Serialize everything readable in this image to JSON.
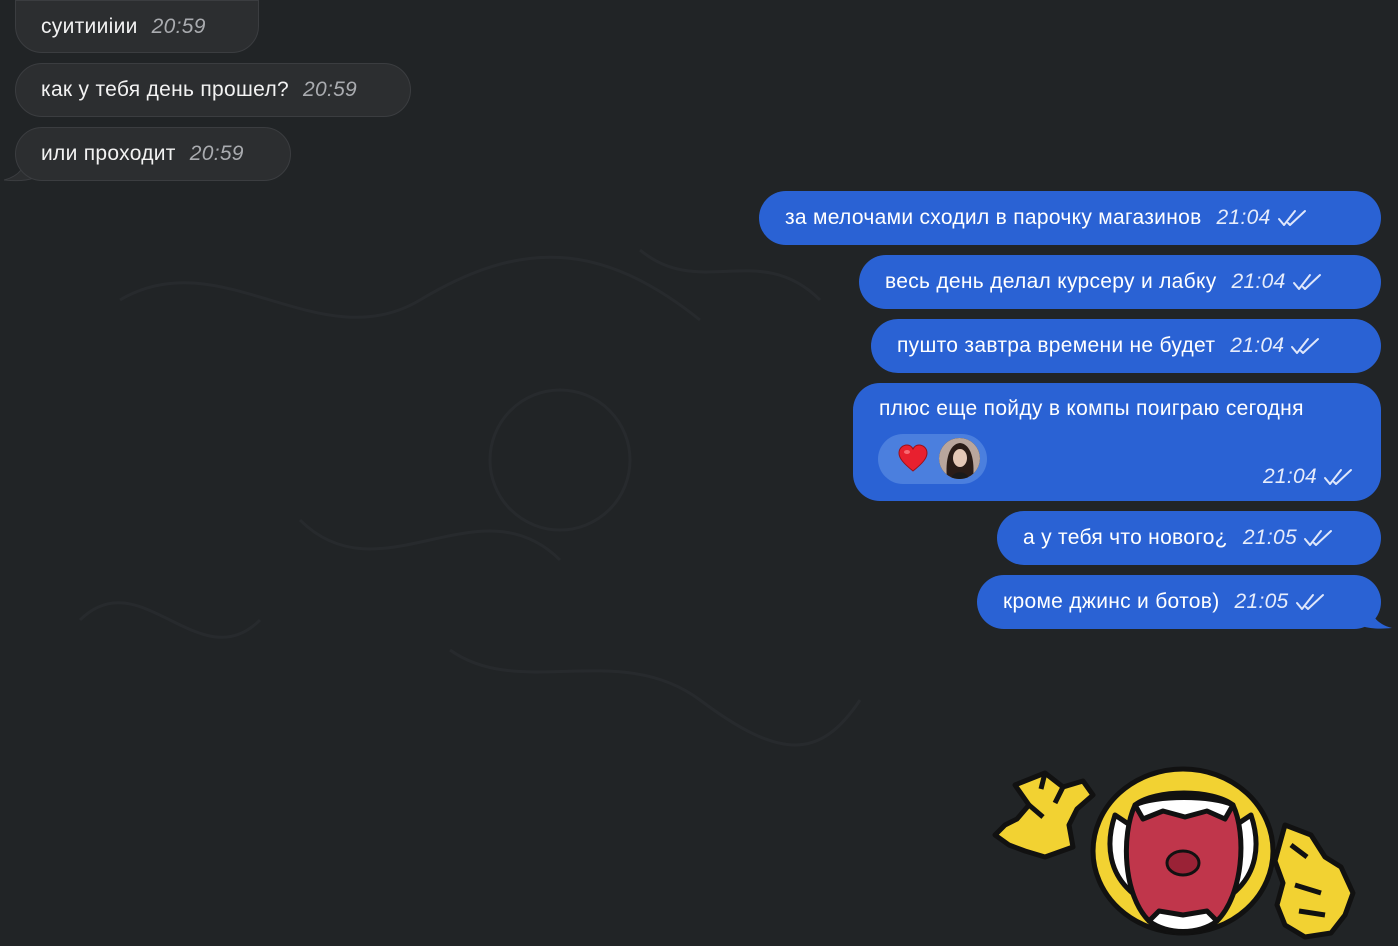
{
  "incoming": [
    {
      "text": "суитииiии",
      "time": "20:59"
    },
    {
      "text": "как у тебя день прошел?",
      "time": "20:59"
    },
    {
      "text": "или проходит",
      "time": "20:59"
    }
  ],
  "outgoing": [
    {
      "text": "за мелочами сходил в парочку магазинов",
      "time": "21:04"
    },
    {
      "text": "весь день делал курсеру и лабку",
      "time": "21:04"
    },
    {
      "text": "пушто завтра времени не будет",
      "time": "21:04"
    },
    {
      "text": "плюс еще пойду в компы поиграю сегодня",
      "time": "21:04",
      "reaction": "heart"
    },
    {
      "text": "а у тебя что нового¿",
      "time": "21:05"
    },
    {
      "text": "кроме джинс и ботов)",
      "time": "21:05"
    }
  ],
  "colors": {
    "background": "#212426",
    "incoming_bubble": "#2c2e30",
    "outgoing_bubble": "#2a62d4",
    "reaction_pill": "#4b7fde"
  },
  "icons": {
    "read_status": "double-check-icon",
    "reaction": "heart-icon",
    "sticker": "screaming-face-sticker"
  }
}
